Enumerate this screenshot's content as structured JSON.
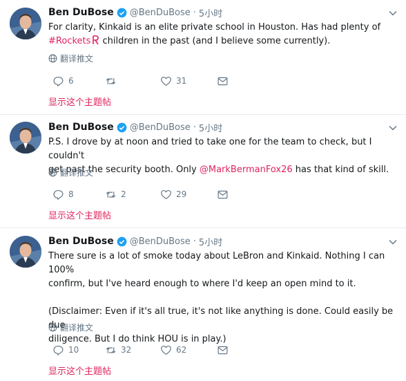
{
  "tweets": [
    {
      "author_name": "Ben DuBose",
      "handle": "@BenDuBose",
      "separator": "·",
      "time": "5小时",
      "text_before": "For clarity, Kinkaid is an elite private school in Houston. Has had plenty of\n",
      "hashtag": "#Rockets",
      "text_after": " children in the past (and I believe some currently).",
      "translate": "翻译推文",
      "replies": "6",
      "retweets": "",
      "likes": "31",
      "show_thread": "显示这个主题帖"
    },
    {
      "author_name": "Ben DuBose",
      "handle": "@BenDuBose",
      "separator": "·",
      "time": "5小时",
      "text_before": "P.S. I drove by at noon and tried to take one for the team to check, but I couldn't\nget past the security booth. Only ",
      "mention": "@MarkBermanFox26",
      "text_after": " has that kind of skill.",
      "translate": "翻译推文",
      "replies": "8",
      "retweets": "2",
      "likes": "29",
      "show_thread": "显示这个主题帖"
    },
    {
      "author_name": "Ben DuBose",
      "handle": "@BenDuBose",
      "separator": "·",
      "time": "5小时",
      "text": "There sure is a lot of smoke today about LeBron and Kinkaid. Nothing I can 100%\nconfirm, but I've heard enough to where I'd keep an open mind to it.\n\n(Disclaimer: Even if it's all true, it's not like anything is done. Could easily be due\ndiligence. But I do think HOU is in play.)",
      "translate": "翻译推文",
      "replies": "10",
      "retweets": "32",
      "likes": "62",
      "show_thread": "显示这个主题帖"
    }
  ],
  "icons": [
    "verified-badge-icon",
    "caret-down-icon",
    "globe-icon",
    "reply-icon",
    "retweet-icon",
    "like-icon",
    "message-icon",
    "rockets-hashflag-icon"
  ],
  "colors": {
    "accent": "#e0245e",
    "muted": "#657786",
    "verified": "#1da1f2",
    "divider": "#e6ecf0"
  }
}
